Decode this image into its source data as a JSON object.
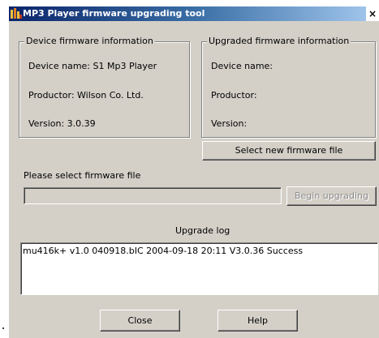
{
  "window": {
    "title": "MP3 Player firmware upgrading tool",
    "close_glyph": "×"
  },
  "device_info": {
    "legend": "Device firmware information",
    "device_name": "Device name: S1 Mp3 Player",
    "productor": "Productor: Wilson Co. Ltd.",
    "version": "Version: 3.0.39"
  },
  "upgraded_info": {
    "legend": "Upgraded firmware information",
    "device_name": "Device name:",
    "productor": "Productor:",
    "version": "Version:"
  },
  "buttons": {
    "select_file": "Select new firmware file",
    "begin_upgrading": "Begin upgrading",
    "close": "Close",
    "help": "Help"
  },
  "file_select": {
    "label": "Please select firmware file",
    "value": ""
  },
  "upgrade_log": {
    "label": "Upgrade log",
    "entries": [
      "mu416k+ v1.0 040918.bIC  2004-09-18  20:11  V3.0.36  Success"
    ]
  },
  "colors": {
    "face": "#d4d0c8",
    "titlebar_start": "#0a246a",
    "titlebar_end": "#a6caf0"
  },
  "icons": [
    "app-icon",
    "close-icon"
  ]
}
